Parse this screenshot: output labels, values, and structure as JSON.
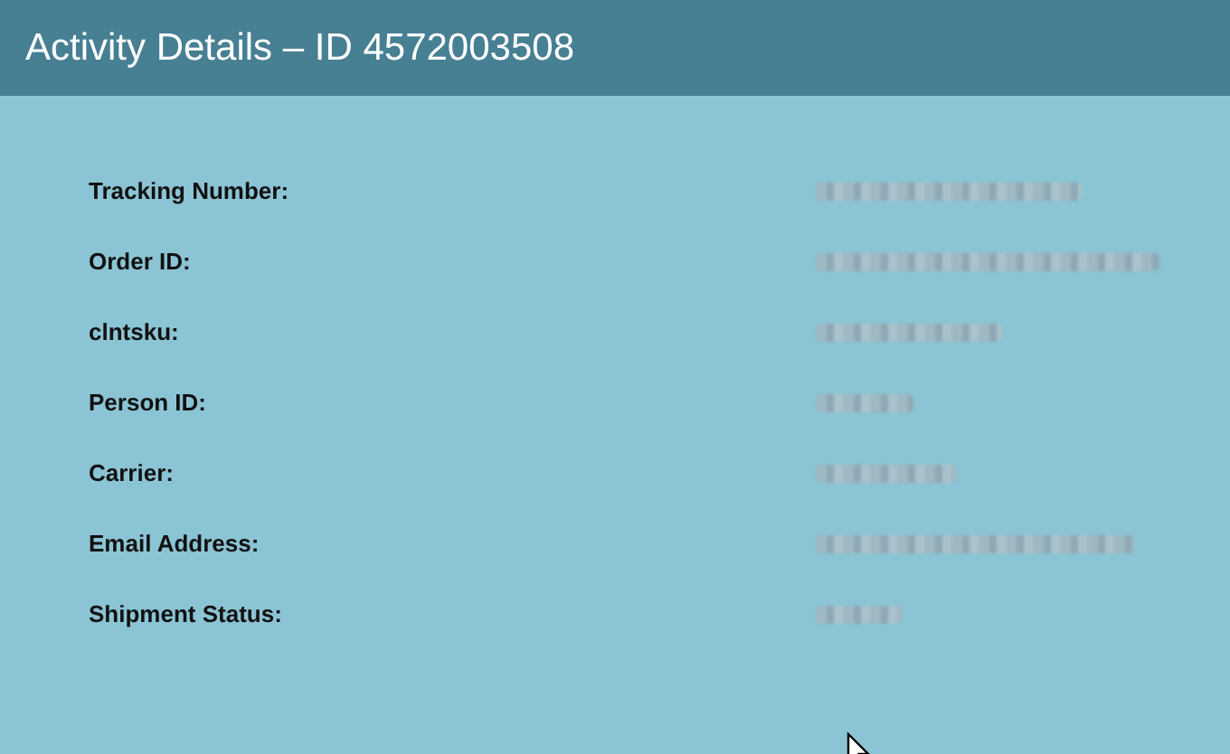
{
  "window": {
    "title": "Activity Details – ID 4572003508"
  },
  "fields": [
    {
      "label": "Tracking Number:",
      "value": {
        "kind": "redacted"
      }
    },
    {
      "label": "Order ID:",
      "value": {
        "kind": "redacted"
      }
    },
    {
      "label": "clntsku:",
      "value": {
        "kind": "redacted"
      }
    },
    {
      "label": "Person ID:",
      "value": {
        "kind": "redacted"
      }
    },
    {
      "label": "Carrier:",
      "value": {
        "kind": "redacted"
      }
    },
    {
      "label": "Email Address:",
      "value": {
        "kind": "redacted"
      }
    },
    {
      "label": "Shipment Status:",
      "value": {
        "kind": "redacted"
      }
    }
  ]
}
